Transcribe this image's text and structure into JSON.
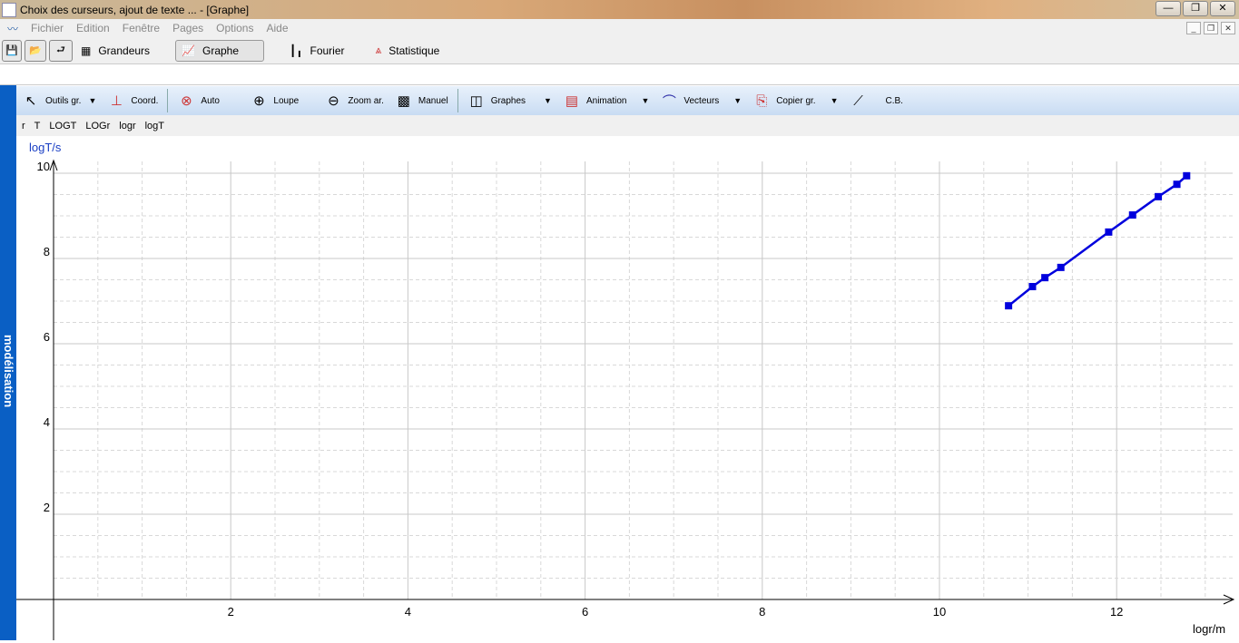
{
  "window": {
    "title": "Choix des curseurs, ajout de texte ... - [Graphe]"
  },
  "menu": [
    "Fichier",
    "Edition",
    "Fenêtre",
    "Pages",
    "Options",
    "Aide"
  ],
  "tabs": [
    "Grandeurs",
    "Graphe",
    "Fourier",
    "Statistique"
  ],
  "graph_toolbar": {
    "outils": "Outils gr.",
    "coord": "Coord.",
    "auto": "Auto",
    "loupe": "Loupe",
    "zoom": "Zoom ar.",
    "manuel": "Manuel",
    "graphes": "Graphes",
    "animation": "Animation",
    "vecteurs": "Vecteurs",
    "copier": "Copier gr.",
    "cb": "C.B."
  },
  "variables": [
    "r",
    "T",
    "LOGT",
    "LOGr",
    "logr",
    "logT"
  ],
  "side_tab": "modélisation",
  "chart_data": {
    "type": "line",
    "xlabel": "logr/m",
    "ylabel": "logT/s",
    "xlim": [
      0,
      13.1
    ],
    "ylim": [
      0,
      10.2
    ],
    "xticks": [
      2,
      4,
      6,
      8,
      10,
      12
    ],
    "yticks": [
      2,
      4,
      6,
      8,
      10
    ],
    "grid": true,
    "color": "#0000dd",
    "series": [
      {
        "name": "logT",
        "x": [
          10.78,
          11.05,
          11.19,
          11.37,
          11.91,
          12.18,
          12.47,
          12.68,
          12.79
        ],
        "y": [
          6.89,
          7.34,
          7.55,
          7.79,
          8.62,
          9.02,
          9.45,
          9.74,
          9.94
        ]
      }
    ]
  }
}
